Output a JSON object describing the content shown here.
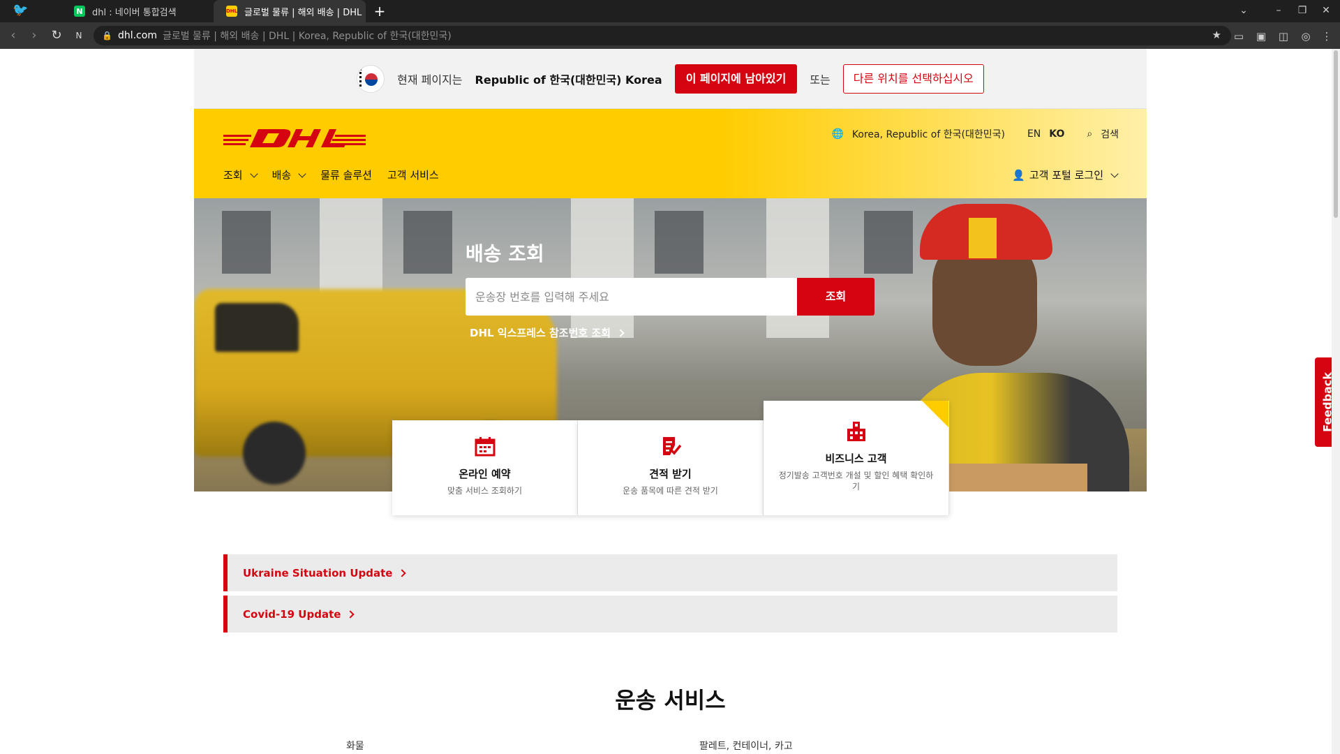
{
  "browser": {
    "tabs": [
      {
        "favicon": "N",
        "title": "dhl : 네이버 통합검색"
      },
      {
        "favicon": "DHL",
        "title": "글로벌 물류 | 해외 배송 | DHL |"
      }
    ],
    "address": {
      "domain": "dhl.com",
      "path_title": "글로벌 물류 | 해외 배송 | DHL | Korea, Republic of 한국(대한민국)"
    }
  },
  "location_bar": {
    "prefix": "현재 페이지는",
    "country": "Republic of 한국(대한민국) Korea",
    "stay_button": "이 페이지에 남아있기",
    "or_text": "또는",
    "choose_button": "다른 위치를 선택하십시오"
  },
  "header": {
    "region": "Korea, Republic of 한국(대한민국)",
    "lang_en": "EN",
    "lang_ko": "KO",
    "search": "검색",
    "nav": [
      {
        "label": "조회"
      },
      {
        "label": "배송"
      },
      {
        "label": "물류 솔루션"
      },
      {
        "label": "고객 서비스"
      }
    ],
    "portal_login": "고객 포털 로그인"
  },
  "hero": {
    "title": "배송 조회",
    "track_placeholder": "운송장 번호를 입력해 주세요",
    "track_button": "조회",
    "reference_link": "DHL 익스프레스 참조번호 조회"
  },
  "cards": [
    {
      "title": "온라인 예약",
      "subtitle": "맞춤 서비스 조회하기",
      "icon": "calendar-icon"
    },
    {
      "title": "견적 받기",
      "subtitle": "운송 품목에 따른 견적 받기",
      "icon": "quote-icon"
    },
    {
      "title": "비즈니스 고객",
      "subtitle": "정기발송 고객번호 개설 및 할인 혜택 확인하기",
      "icon": "building-icon"
    }
  ],
  "notices": [
    {
      "label": "Ukraine Situation Update"
    },
    {
      "label": "Covid-19 Update"
    }
  ],
  "services": {
    "title": "운송 서비스",
    "labels": [
      "화물",
      "팔레트, 컨테이너, 카고"
    ]
  },
  "feedback": "Feedback",
  "colors": {
    "dhl_red": "#d40511",
    "dhl_yellow": "#ffcc00"
  }
}
